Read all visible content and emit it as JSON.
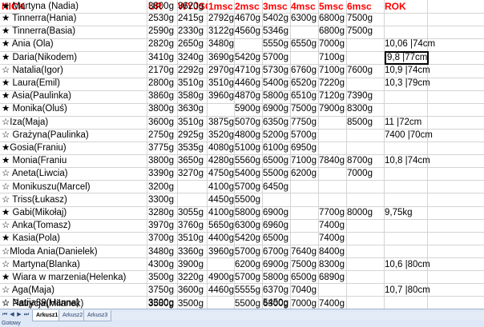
{
  "headers": {
    "nick": "NICK",
    "ur": "UR",
    "wyjscie": "WYJSC",
    "m1": "1msc",
    "m2": "2msc",
    "m3": "3msc",
    "m4": "4msc",
    "m5": "5msc",
    "m6": "6msc",
    "rok": "ROK"
  },
  "rows": [
    {
      "nick": "★ Tinnerra(Hania)",
      "ur": "2530g",
      "wyj": "2415g",
      "m1": "2792g",
      "m2": "4670g",
      "m3": "5402g",
      "m4": "6300g",
      "m5": "6800g",
      "m6": "7500g",
      "rok": ""
    },
    {
      "nick": "★ Tinnerra(Basia)",
      "ur": "2590g",
      "wyj": "2330g",
      "m1": "3122g",
      "m2": "4560g",
      "m3": "5346g",
      "m4": "",
      "m5": "6800g",
      "m6": "7500g",
      "rok": ""
    },
    {
      "nick": "★ Ania (Ola)",
      "ur": "2820g",
      "wyj": "2650g",
      "m1": "3480g",
      "m2": "",
      "m3": "5550g",
      "m4": "6550g",
      "m5": "7000g",
      "m6": "",
      "rok": "10,06 |74cm"
    },
    {
      "nick": "★ Daria(Nikodem)",
      "ur": "3410g",
      "wyj": "3240g",
      "m1": "3690g",
      "m2": "5420g",
      "m3": "5700g",
      "m4": "",
      "m5": "7100g",
      "m6": "",
      "rok": "9,8 |77cm"
    },
    {
      "nick": "☆ Natalia(Igor)",
      "ur": "2170g",
      "wyj": "2292g",
      "m1": "2970g",
      "m2": "4710g",
      "m3": "5730g",
      "m4": "6760g",
      "m5": "7100g",
      "m6": "7600g",
      "rok": "10,9 |74cm"
    },
    {
      "nick": "★ Laura(Emil)",
      "ur": "2800g",
      "wyj": "3510g",
      "m1": "3510g",
      "m2": "4460g",
      "m3": "5400g",
      "m4": "6520g",
      "m5": "7220g",
      "m6": "",
      "rok": "10,3 |79cm"
    },
    {
      "nick": "★ Asia(Paulinka)",
      "ur": "3860g",
      "wyj": "3580g",
      "m1": "3960g",
      "m2": "4870g",
      "m3": "5800g",
      "m4": "6510g",
      "m5": "7120g",
      "m6": "7390g",
      "rok": ""
    },
    {
      "nick": "★ Monika(Oluś)",
      "ur": "3800g",
      "wyj": "3630g",
      "m1": "",
      "m2": "5900g",
      "m3": "6900g",
      "m4": "7500g",
      "m5": "7900g",
      "m6": "8300g",
      "rok": ""
    },
    {
      "nick": "☆Iza(Maja)",
      "ur": "3600g",
      "wyj": "3510g",
      "m1": "3875g",
      "m2": "5070g",
      "m3": "6350g",
      "m4": "7750g",
      "m5": "",
      "m6": "8500g",
      "rok": "11 |72cm"
    },
    {
      "nick": "☆ Grażyna(Paulinka)",
      "ur": "2750g",
      "wyj": "2925g",
      "m1": "3520g",
      "m2": "4800g",
      "m3": "5200g",
      "m4": "5700g",
      "m5": "",
      "m6": "",
      "rok": "7400 |70cm"
    },
    {
      "nick": "★Gosia(Franiu)",
      "ur": "3775g",
      "wyj": "3535g",
      "m1": "4080g",
      "m2": "5100g",
      "m3": "6100g",
      "m4": "6950g",
      "m5": "",
      "m6": "",
      "rok": ""
    },
    {
      "nick": "★ Monia(Franiu",
      "ur": "3800g",
      "wyj": "3650g",
      "m1": "4280g",
      "m2": "5560g",
      "m3": "6500g",
      "m4": "7100g",
      "m5": "7840g",
      "m6": "8700g",
      "rok": "10,8 |74cm"
    },
    {
      "nick": "☆ Aneta(Liwcia)",
      "ur": "3390g",
      "wyj": "3270g",
      "m1": "4750g",
      "m2": "5400g",
      "m3": "5500g",
      "m4": "6200g",
      "m5": "",
      "m6": "7000g",
      "rok": ""
    },
    {
      "nick": "☆ Monikuszu(Marcel)",
      "ur": "3200g",
      "wyj": "",
      "m1": "4100g",
      "m2": "5700g",
      "m3": "6450g",
      "m4": "",
      "m5": "",
      "m6": "",
      "rok": ""
    },
    {
      "nick": "☆ Triss(Łukasz)",
      "ur": "3300g",
      "wyj": "",
      "m1": "4450g",
      "m2": "5500g",
      "m3": "",
      "m4": "",
      "m5": "",
      "m6": "",
      "rok": ""
    },
    {
      "nick": "★ Gabi(Mikołaj)",
      "ur": "3280g",
      "wyj": "3055g",
      "m1": "4100g",
      "m2": "5800g",
      "m3": "6900g",
      "m4": "",
      "m5": "7700g",
      "m6": "8000g",
      "rok": "9,75kg"
    },
    {
      "nick": "☆ Anka(Tomasz)",
      "ur": "3970g",
      "wyj": "3760g",
      "m1": "5650g",
      "m2": "6300g",
      "m3": "6960g",
      "m4": "",
      "m5": "7400g",
      "m6": "",
      "rok": ""
    },
    {
      "nick": "★ Kasia(Pola)",
      "ur": "3700g",
      "wyj": "3510g",
      "m1": "4400g",
      "m2": "5420g",
      "m3": "6500g",
      "m4": "",
      "m5": "7400g",
      "m6": "",
      "rok": ""
    },
    {
      "nick": "☆Mloda Ania(Danielek)",
      "ur": "3480g",
      "wyj": "3360g",
      "m1": "3960g",
      "m2": "5700g",
      "m3": "6700g",
      "m4": "7640g",
      "m5": "8400g",
      "m6": "",
      "rok": ""
    },
    {
      "nick": "☆ Martyna(Blanka)",
      "ur": "4300g",
      "wyj": "3900g",
      "m1": "",
      "m2": "6200g",
      "m3": "6900g",
      "m4": "7500g",
      "m5": "8300g",
      "m6": "",
      "rok": "10,6 |80cm"
    },
    {
      "nick": "★ Wiara w marzenia(Helenka)",
      "ur": "3500g",
      "wyj": "3220g",
      "m1": "4900g",
      "m2": "5700g",
      "m3": "5800g",
      "m4": "6500g",
      "m5": "6890g",
      "m6": "",
      "rok": ""
    },
    {
      "nick": "☆ Aga(Maja)",
      "ur": "3750g",
      "wyj": "3600g",
      "m1": "4460g",
      "m2": "5555g",
      "m3": "6370g",
      "m4": "7040g",
      "m5": "",
      "m6": "",
      "rok": "10,7 |80cm"
    },
    {
      "nick": "☆ Natija89(Hanna)",
      "ur": "3300g",
      "wyj": "",
      "m1": "",
      "m2": "",
      "m3": "5450g",
      "m4": "",
      "m5": "",
      "m6": "",
      "rok": ""
    },
    {
      "nick": "☆ Patrycja(Milanek)",
      "ur": "3580g",
      "wyj": "3500g",
      "m1": "",
      "m2": "5500g",
      "m3": "6300g",
      "m4": "7000g",
      "m5": "7400g",
      "m6": "",
      "rok": ""
    },
    {
      "nick": "★ Martyna (Nadia)",
      "ur": "3800g",
      "wyj": "3620g",
      "m1": "",
      "m2": "",
      "m3": "",
      "m4": "",
      "m5": "",
      "m6": "",
      "rok": ""
    }
  ],
  "selected_cell": {
    "row": 3,
    "col": "rok"
  },
  "sheet_tabs": [
    "Arkusz1",
    "Arkusz2",
    "Arkusz3"
  ],
  "active_tab": "Arkusz1",
  "status": "Gotowy",
  "colors": {
    "header": "#ff0000",
    "grid": "#d4d4d4",
    "tabbar": "#dfe8f6"
  }
}
